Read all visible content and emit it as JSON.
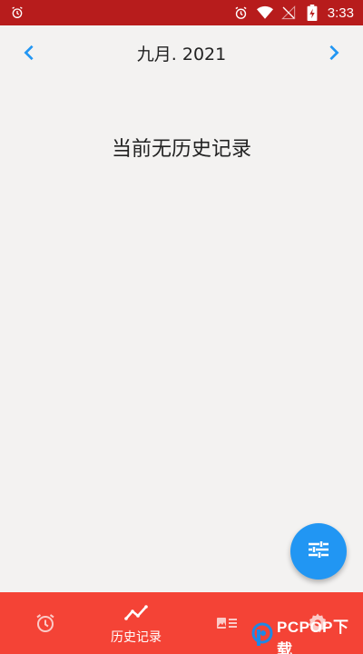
{
  "status_bar": {
    "time": "3:33",
    "icons": [
      "alarm-icon",
      "alarm-icon",
      "wifi-icon",
      "no-signal-icon",
      "battery-charging-icon"
    ]
  },
  "header": {
    "month_label": "九月. 2021",
    "prev_icon": "chevron-left-icon",
    "next_icon": "chevron-right-icon"
  },
  "main": {
    "empty_message": "当前无历史记录"
  },
  "fab": {
    "icon": "tune-icon"
  },
  "bottom_nav": {
    "items": [
      {
        "icon": "alarm-icon",
        "label": ""
      },
      {
        "icon": "trending-icon",
        "label": "历史记录",
        "active": true
      },
      {
        "icon": "photo-list-icon",
        "label": ""
      },
      {
        "icon": "gear-icon",
        "label": ""
      }
    ]
  },
  "watermark": {
    "text": "PCPOP下载"
  },
  "colors": {
    "status_bar": "#b71c1c",
    "bottom_nav": "#f44336",
    "accent": "#2196f3",
    "background": "#f3f2f1"
  }
}
